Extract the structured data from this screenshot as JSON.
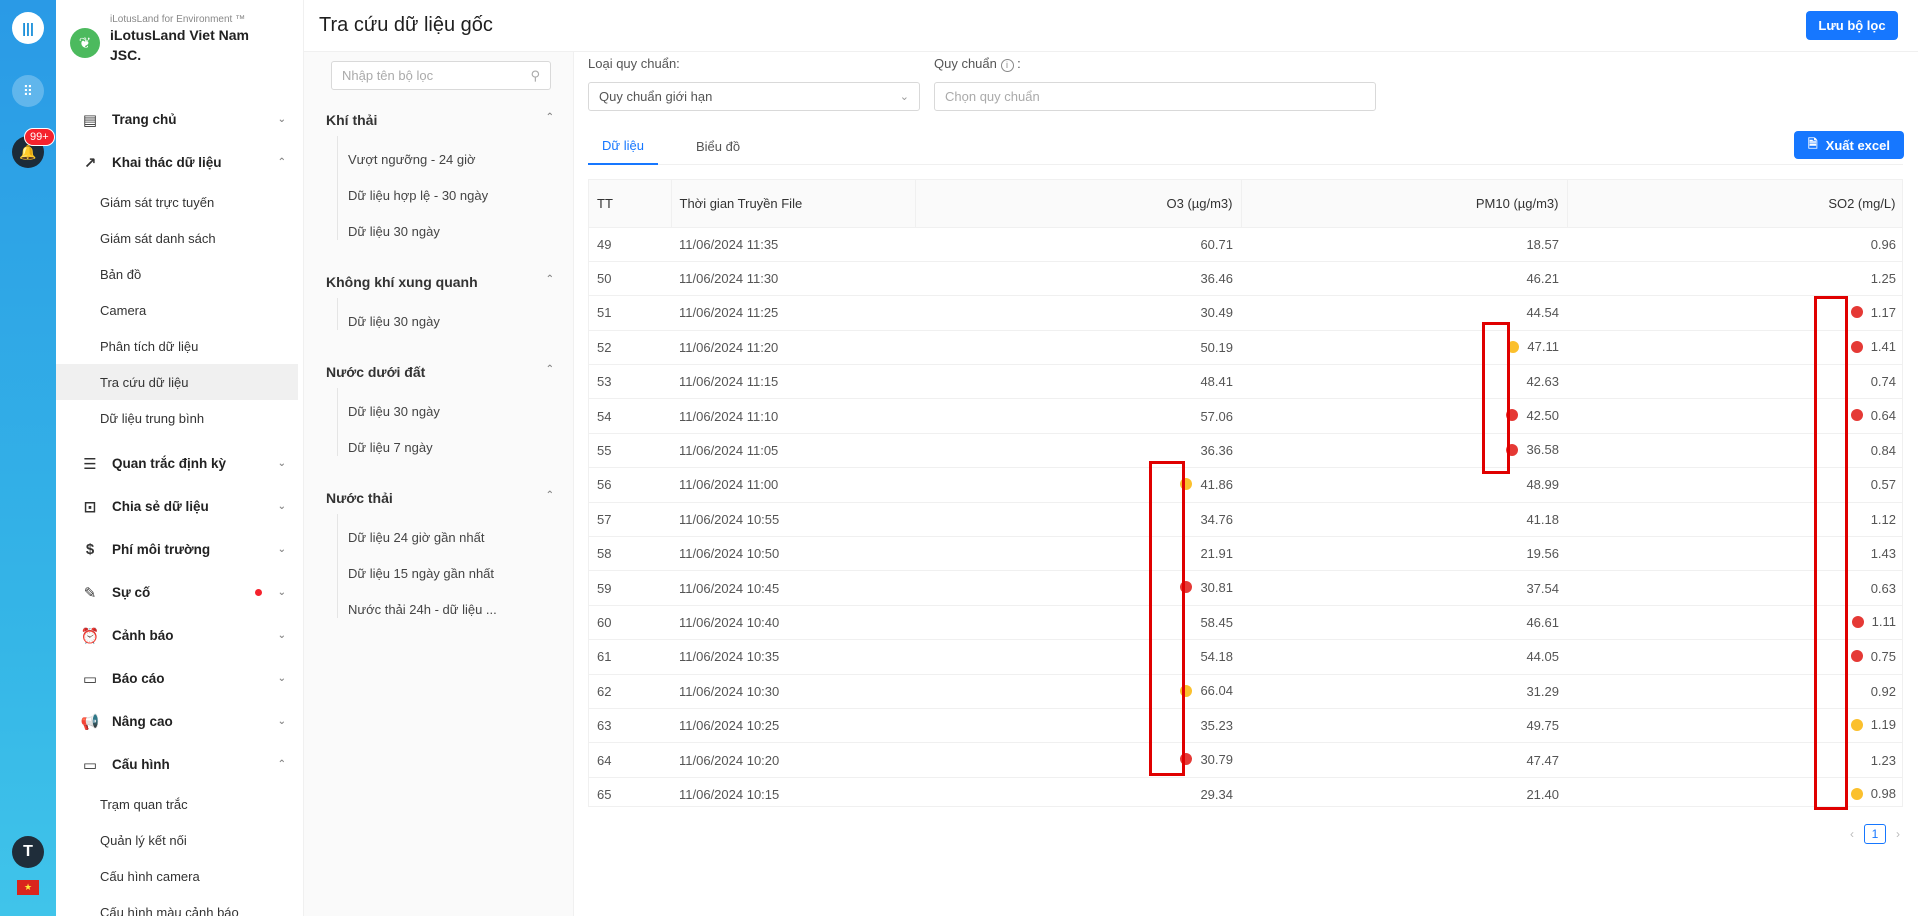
{
  "rail": {
    "badge": "99+",
    "avatar_initial": "T",
    "flag": "★"
  },
  "brand": {
    "sub": "iLotusLand for Environment ™",
    "name": "iLotusLand Viet Nam JSC."
  },
  "menu": [
    {
      "label": "Trang chủ",
      "icon": "▤"
    },
    {
      "label": "Khai thác dữ liệu",
      "icon": "↗"
    },
    {
      "label": "Quan trắc định kỳ",
      "icon": "☰"
    },
    {
      "label": "Chia sẻ dữ liệu",
      "icon": "⊡"
    },
    {
      "label": "Phí môi trường",
      "icon": "$"
    },
    {
      "label": "Sự cố",
      "icon": "✎"
    },
    {
      "label": "Cảnh báo",
      "icon": "⏰"
    },
    {
      "label": "Báo cáo",
      "icon": "▭"
    },
    {
      "label": "Nâng cao",
      "icon": "📢"
    },
    {
      "label": "Cấu hình",
      "icon": "▭"
    }
  ],
  "submenu_data": [
    "Giám sát trực tuyến",
    "Giám sát danh sách",
    "Bản đồ",
    "Camera",
    "Phân tích dữ liệu",
    "Tra cứu dữ liệu",
    "Dữ liệu trung bình"
  ],
  "submenu_config": [
    "Trạm quan trắc",
    "Quản lý kết nối",
    "Cấu hình camera",
    "Cấu hình màu cảnh báo"
  ],
  "header": {
    "title": "Tra cứu dữ liệu gốc",
    "save_label": "Lưu bộ lọc"
  },
  "filter": {
    "search_placeholder": "Nhập tên bộ lọc",
    "groups": [
      {
        "title": "Khí thải",
        "items": [
          "Vượt ngưỡng - 24 giờ",
          "Dữ liệu hợp lệ - 30 ngày",
          "Dữ liệu 30 ngày"
        ]
      },
      {
        "title": "Không khí xung quanh",
        "items": [
          "Dữ liệu 30 ngày"
        ]
      },
      {
        "title": "Nước dưới đất",
        "items": [
          "Dữ liệu 30 ngày",
          "Dữ liệu 7 ngày"
        ]
      },
      {
        "title": "Nước thải",
        "items": [
          "Dữ liệu 24 giờ gần nhất",
          "Dữ liệu 15 ngày gần nhất",
          "Nước thải 24h - dữ liệu ..."
        ]
      }
    ]
  },
  "fields": {
    "standard_type_label": "Loại quy chuẩn:",
    "standard_type_value": "Quy chuẩn giới hạn",
    "standard_label": "Quy chuẩn",
    "standard_colon": ":",
    "standard_placeholder": "Chọn quy chuẩn"
  },
  "tabs": [
    "Dữ liệu",
    "Biểu đồ"
  ],
  "export_label": "Xuất excel",
  "table": {
    "columns": [
      "TT",
      "Thời gian Truyền File",
      "O3 (µg/m3)",
      "PM10 (µg/m3)",
      "SO2 (mg/L)"
    ],
    "rows": [
      {
        "tt": "49",
        "time": "11/06/2024 11:35",
        "o3": "60.71",
        "o3_dot": "",
        "pm10": "18.57",
        "pm10_dot": "",
        "so2": "0.96",
        "so2_dot": ""
      },
      {
        "tt": "50",
        "time": "11/06/2024 11:30",
        "o3": "36.46",
        "o3_dot": "",
        "pm10": "46.21",
        "pm10_dot": "",
        "so2": "1.25",
        "so2_dot": ""
      },
      {
        "tt": "51",
        "time": "11/06/2024 11:25",
        "o3": "30.49",
        "o3_dot": "",
        "pm10": "44.54",
        "pm10_dot": "",
        "so2": "1.17",
        "so2_dot": "red"
      },
      {
        "tt": "52",
        "time": "11/06/2024 11:20",
        "o3": "50.19",
        "o3_dot": "",
        "pm10": "47.11",
        "pm10_dot": "yellow",
        "so2": "1.41",
        "so2_dot": "red"
      },
      {
        "tt": "53",
        "time": "11/06/2024 11:15",
        "o3": "48.41",
        "o3_dot": "",
        "pm10": "42.63",
        "pm10_dot": "",
        "so2": "0.74",
        "so2_dot": ""
      },
      {
        "tt": "54",
        "time": "11/06/2024 11:10",
        "o3": "57.06",
        "o3_dot": "",
        "pm10": "42.50",
        "pm10_dot": "red",
        "so2": "0.64",
        "so2_dot": "red"
      },
      {
        "tt": "55",
        "time": "11/06/2024 11:05",
        "o3": "36.36",
        "o3_dot": "",
        "pm10": "36.58",
        "pm10_dot": "red",
        "so2": "0.84",
        "so2_dot": ""
      },
      {
        "tt": "56",
        "time": "11/06/2024 11:00",
        "o3": "41.86",
        "o3_dot": "yellow",
        "pm10": "48.99",
        "pm10_dot": "",
        "so2": "0.57",
        "so2_dot": ""
      },
      {
        "tt": "57",
        "time": "11/06/2024 10:55",
        "o3": "34.76",
        "o3_dot": "",
        "pm10": "41.18",
        "pm10_dot": "",
        "so2": "1.12",
        "so2_dot": ""
      },
      {
        "tt": "58",
        "time": "11/06/2024 10:50",
        "o3": "21.91",
        "o3_dot": "",
        "pm10": "19.56",
        "pm10_dot": "",
        "so2": "1.43",
        "so2_dot": ""
      },
      {
        "tt": "59",
        "time": "11/06/2024 10:45",
        "o3": "30.81",
        "o3_dot": "red",
        "pm10": "37.54",
        "pm10_dot": "",
        "so2": "0.63",
        "so2_dot": ""
      },
      {
        "tt": "60",
        "time": "11/06/2024 10:40",
        "o3": "58.45",
        "o3_dot": "",
        "pm10": "46.61",
        "pm10_dot": "",
        "so2": "1.11",
        "so2_dot": "red"
      },
      {
        "tt": "61",
        "time": "11/06/2024 10:35",
        "o3": "54.18",
        "o3_dot": "",
        "pm10": "44.05",
        "pm10_dot": "",
        "so2": "0.75",
        "so2_dot": "red"
      },
      {
        "tt": "62",
        "time": "11/06/2024 10:30",
        "o3": "66.04",
        "o3_dot": "yellow",
        "pm10": "31.29",
        "pm10_dot": "",
        "so2": "0.92",
        "so2_dot": ""
      },
      {
        "tt": "63",
        "time": "11/06/2024 10:25",
        "o3": "35.23",
        "o3_dot": "",
        "pm10": "49.75",
        "pm10_dot": "",
        "so2": "1.19",
        "so2_dot": "yellow"
      },
      {
        "tt": "64",
        "time": "11/06/2024 10:20",
        "o3": "30.79",
        "o3_dot": "red",
        "pm10": "47.47",
        "pm10_dot": "",
        "so2": "1.23",
        "so2_dot": ""
      },
      {
        "tt": "65",
        "time": "11/06/2024 10:15",
        "o3": "29.34",
        "o3_dot": "",
        "pm10": "21.40",
        "pm10_dot": "",
        "so2": "0.98",
        "so2_dot": "yellow"
      }
    ]
  },
  "pagination": {
    "prev": "‹",
    "current": "1",
    "next": "›"
  },
  "colors": {
    "primary": "#1677ff",
    "alert_red": "#e53935",
    "alert_yellow": "#fbc02d",
    "highlight_box": "#e00000"
  }
}
